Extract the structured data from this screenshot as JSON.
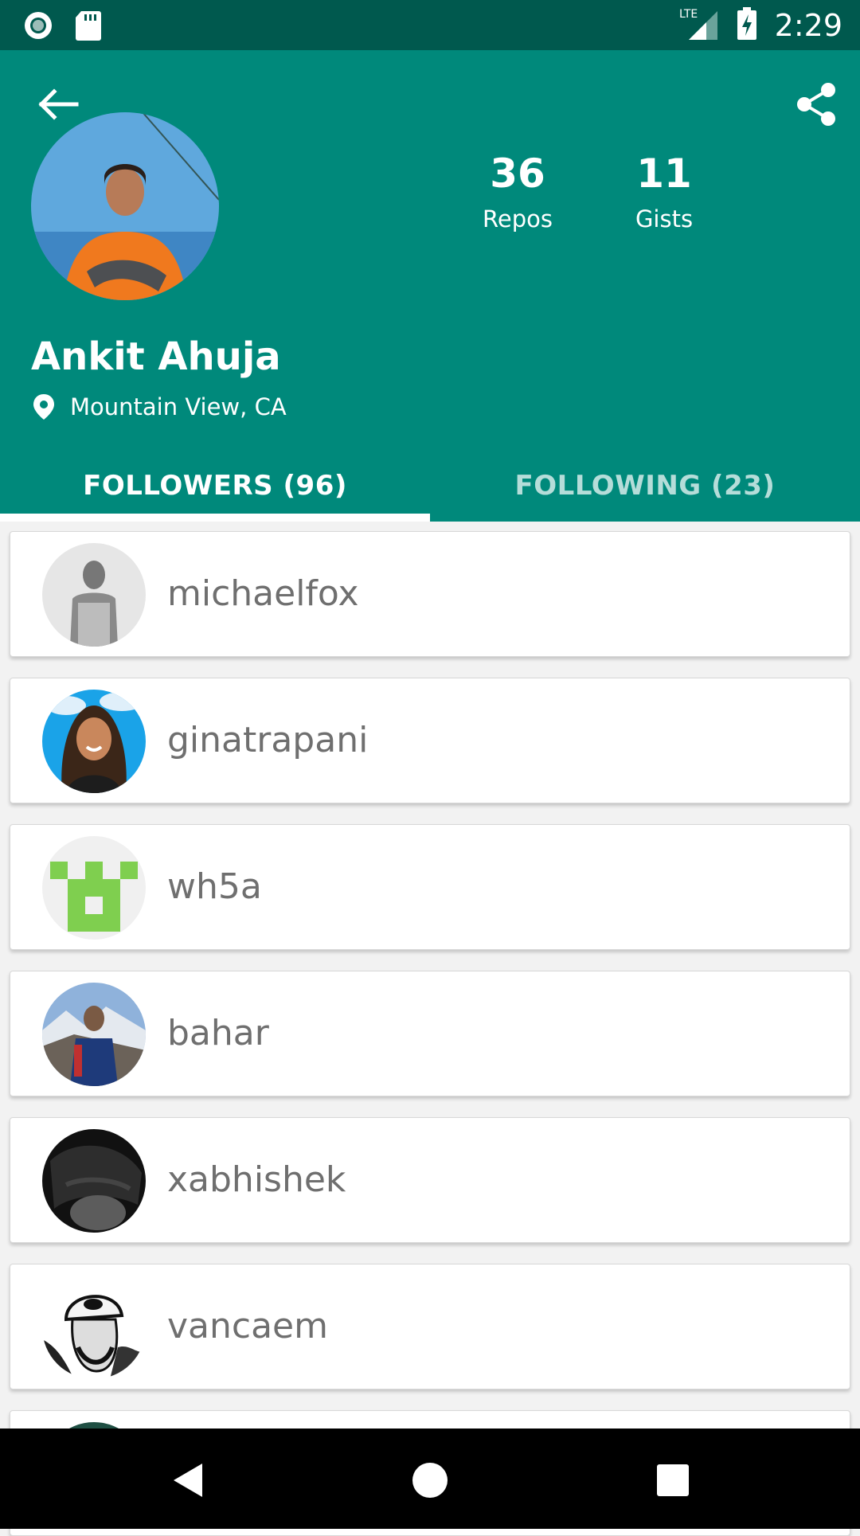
{
  "status_bar": {
    "time": "2:29",
    "network": "LTE"
  },
  "profile": {
    "name": "Ankit Ahuja",
    "location": "Mountain View, CA",
    "stats": {
      "repos_count": "36",
      "repos_label": "Repos",
      "gists_count": "11",
      "gists_label": "Gists"
    }
  },
  "tabs": {
    "followers": "FOLLOWERS  (96)",
    "following": "FOLLOWING  (23)",
    "active": "followers"
  },
  "followers": [
    {
      "username": "michaelfox"
    },
    {
      "username": "ginatrapani"
    },
    {
      "username": "wh5a"
    },
    {
      "username": "bahar"
    },
    {
      "username": "xabhishek"
    },
    {
      "username": "vancaem"
    }
  ],
  "colors": {
    "primary": "#00897b",
    "primary_dark": "#00594e",
    "tab_inactive": "#b5ddd9"
  },
  "icons": {
    "back": "arrow-back-icon",
    "share": "share-icon",
    "location": "location-pin-icon"
  }
}
